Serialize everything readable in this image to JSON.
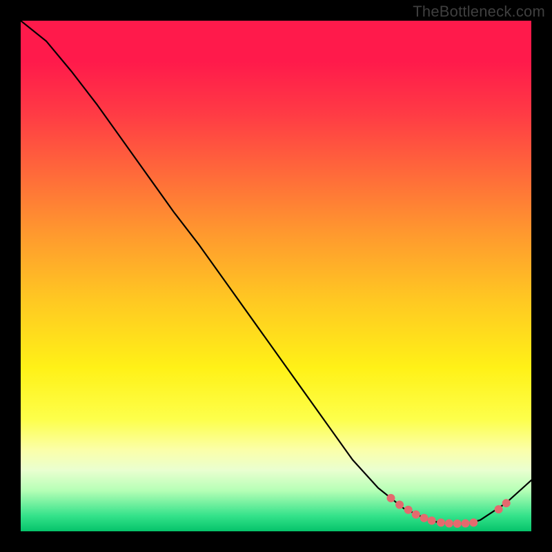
{
  "watermark": "TheBottleneck.com",
  "chart_data": {
    "type": "line",
    "title": "",
    "xlabel": "",
    "ylabel": "",
    "xlim": [
      0,
      100
    ],
    "ylim": [
      0,
      100
    ],
    "grid": false,
    "legend": false,
    "background": "red-yellow-green vertical gradient",
    "series": [
      {
        "name": "curve",
        "x": [
          0,
          5,
          10,
          15,
          20,
          25,
          30,
          35,
          40,
          45,
          50,
          55,
          60,
          65,
          70,
          75,
          80,
          82,
          85,
          88,
          90,
          95,
          100
        ],
        "y": [
          100,
          96,
          90,
          83.5,
          76.5,
          69.5,
          62.5,
          56,
          49,
          42,
          35,
          28,
          21,
          14,
          8.5,
          4.5,
          2.2,
          1.7,
          1.5,
          1.6,
          2.2,
          5.5,
          10
        ],
        "stroke": "#000000",
        "stroke_width": 2.2
      }
    ],
    "markers": [
      {
        "x": 72.5,
        "y": 6.5
      },
      {
        "x": 74.2,
        "y": 5.2
      },
      {
        "x": 75.9,
        "y": 4.2
      },
      {
        "x": 77.4,
        "y": 3.3
      },
      {
        "x": 79.0,
        "y": 2.6
      },
      {
        "x": 80.5,
        "y": 2.1
      },
      {
        "x": 82.3,
        "y": 1.7
      },
      {
        "x": 83.9,
        "y": 1.55
      },
      {
        "x": 85.5,
        "y": 1.5
      },
      {
        "x": 87.1,
        "y": 1.55
      },
      {
        "x": 88.7,
        "y": 1.7
      },
      {
        "x": 93.6,
        "y": 4.3
      },
      {
        "x": 95.1,
        "y": 5.5
      }
    ],
    "marker_style": {
      "fill": "#e46a6e",
      "radius_px": 6
    }
  }
}
